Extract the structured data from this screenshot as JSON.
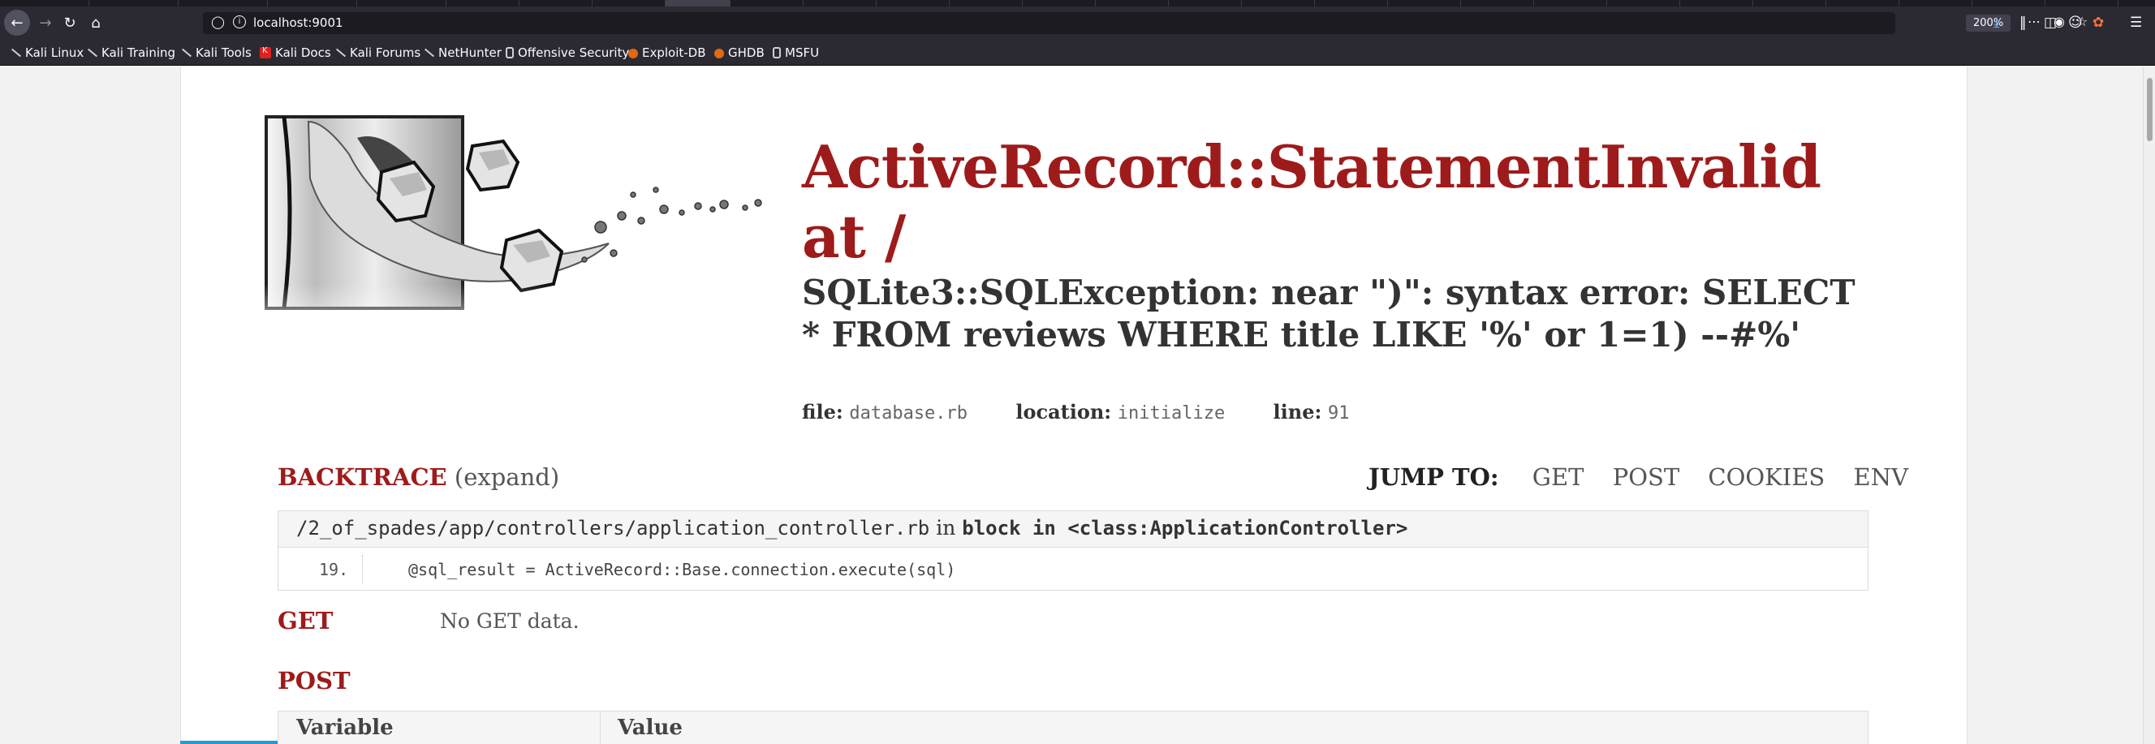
{
  "browser": {
    "url": "localhost:9001",
    "zoom": "200%",
    "bookmarks": [
      {
        "label": "Kali Linux",
        "icon": "kali-dragon-icon"
      },
      {
        "label": "Kali Training",
        "icon": "kali-dragon-icon"
      },
      {
        "label": "Kali Tools",
        "icon": "kali-dragon-icon"
      },
      {
        "label": "Kali Docs",
        "icon": "kali-docs-icon"
      },
      {
        "label": "Kali Forums",
        "icon": "kali-dragon-icon"
      },
      {
        "label": "NetHunter",
        "icon": "kali-dragon-icon"
      },
      {
        "label": "Offensive Security",
        "icon": "offsec-icon"
      },
      {
        "label": "Exploit-DB",
        "icon": "exploit-db-icon"
      },
      {
        "label": "GHDB",
        "icon": "exploit-db-icon"
      },
      {
        "label": "MSFU",
        "icon": "offsec-icon"
      }
    ]
  },
  "error": {
    "title": "ActiveRecord::StatementInvalid at /",
    "message": "SQLite3::SQLException: near \")\": syntax error: SELECT * FROM reviews WHERE title LIKE '%' or 1=1) --#%'",
    "file_label": "file:",
    "file": "database.rb",
    "location_label": "location:",
    "location": "initialize",
    "line_label": "line:",
    "line": "91"
  },
  "backtrace": {
    "heading": "BACKTRACE",
    "expand": "(expand)",
    "frame": {
      "path": "/2_of_spades/app/controllers/application_controller.rb",
      "in_text": "in",
      "block": "block in <class:ApplicationController>",
      "line_number": "19.",
      "code": "@sql_result = ActiveRecord::Base.connection.execute(sql)"
    }
  },
  "jump_to": {
    "label": "JUMP TO:",
    "links": [
      "GET",
      "POST",
      "COOKIES",
      "ENV"
    ]
  },
  "get": {
    "heading": "GET",
    "empty_text": "No GET data."
  },
  "post": {
    "heading": "POST",
    "columns": [
      "Variable",
      "Value"
    ]
  },
  "colors": {
    "accent_red": "#9e1b1b",
    "browser_chrome": "#2b2a33",
    "url_bar": "#1c1b22"
  }
}
